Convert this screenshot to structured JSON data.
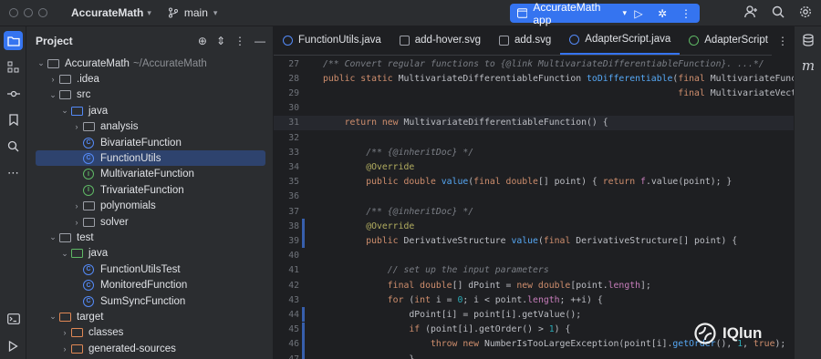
{
  "titlebar": {
    "project": "AccurateMath",
    "branch": "main",
    "run_config": "AccurateMath app"
  },
  "project_panel": {
    "title": "Project",
    "tree": [
      {
        "label": "AccurateMath",
        "suffix": "~/AccurateMath",
        "depth": 0,
        "arrow": "▾",
        "icon": "folder"
      },
      {
        "label": ".idea",
        "depth": 1,
        "arrow": "›",
        "icon": "folder"
      },
      {
        "label": "src",
        "depth": 1,
        "arrow": "▾",
        "icon": "folder"
      },
      {
        "label": "java",
        "depth": 2,
        "arrow": "▾",
        "icon": "folder-blue"
      },
      {
        "label": "analysis",
        "depth": 3,
        "arrow": "›",
        "icon": "package"
      },
      {
        "label": "BivariateFunction",
        "depth": 3,
        "arrow": "",
        "icon": "class"
      },
      {
        "label": "FunctionUtils",
        "depth": 3,
        "arrow": "",
        "icon": "class",
        "selected": true
      },
      {
        "label": "MultivariateFunction",
        "depth": 3,
        "arrow": "",
        "icon": "interface"
      },
      {
        "label": "TrivariateFunction",
        "depth": 3,
        "arrow": "",
        "icon": "interface"
      },
      {
        "label": "polynomials",
        "depth": 3,
        "arrow": "›",
        "icon": "package"
      },
      {
        "label": "solver",
        "depth": 3,
        "arrow": "›",
        "icon": "package"
      },
      {
        "label": "test",
        "depth": 1,
        "arrow": "▾",
        "icon": "folder"
      },
      {
        "label": "java",
        "depth": 2,
        "arrow": "▾",
        "icon": "folder-green"
      },
      {
        "label": "FunctionUtilsTest",
        "depth": 3,
        "arrow": "",
        "icon": "class"
      },
      {
        "label": "MonitoredFunction",
        "depth": 3,
        "arrow": "",
        "icon": "class"
      },
      {
        "label": "SumSyncFunction",
        "depth": 3,
        "arrow": "",
        "icon": "class"
      },
      {
        "label": "target",
        "depth": 1,
        "arrow": "▾",
        "icon": "folder-orange"
      },
      {
        "label": "classes",
        "depth": 2,
        "arrow": "›",
        "icon": "folder-orange"
      },
      {
        "label": "generated-sources",
        "depth": 2,
        "arrow": "›",
        "icon": "folder-orange"
      }
    ]
  },
  "tabs": [
    {
      "label": "FunctionUtils.java",
      "icon": "class"
    },
    {
      "label": "add-hover.svg",
      "icon": "svg"
    },
    {
      "label": "add.svg",
      "icon": "svg"
    },
    {
      "label": "AdapterScript.java",
      "icon": "class",
      "active": true
    },
    {
      "label": "AdapterScript",
      "icon": "green"
    }
  ],
  "code_lines": [
    {
      "num": "27",
      "mark": "",
      "html": "<span class=\"c\">/** Convert regular functions to {@link MultivariateDifferentiableFunction}. ...*/</span>"
    },
    {
      "num": "28",
      "mark": "",
      "html": "<span class=\"k\">public static </span>MultivariateDifferentiableFunction <span class=\"f\">toDifferentiable</span>(<span class=\"k\">final </span>MultivariateFunctio"
    },
    {
      "num": "29",
      "mark": "",
      "html": "                                                                  <span class=\"k\">final </span>MultivariateVectorF"
    },
    {
      "num": "30",
      "mark": "",
      "html": ""
    },
    {
      "num": "31",
      "mark": "",
      "html": "    <span class=\"k\">return new </span>MultivariateDifferentiableFunction() {",
      "hl": true
    },
    {
      "num": "32",
      "mark": "",
      "html": ""
    },
    {
      "num": "33",
      "mark": "",
      "html": "        <span class=\"c\">/** {@inheritDoc} */</span>"
    },
    {
      "num": "34",
      "mark": "",
      "html": "        <span class=\"a\">@Override</span>"
    },
    {
      "num": "35",
      "mark": "",
      "html": "        <span class=\"k\">public double </span><span class=\"f\">value</span>(<span class=\"k\">final double</span>[] point) { <span class=\"k\">return </span><span class=\"fld\">f</span>.value(point); }"
    },
    {
      "num": "36",
      "mark": "",
      "html": ""
    },
    {
      "num": "37",
      "mark": "",
      "html": "        <span class=\"c\">/** {@inheritDoc} */</span>"
    },
    {
      "num": "38",
      "mark": "mod",
      "html": "        <span class=\"a\">@Override</span>"
    },
    {
      "num": "39",
      "mark": "mod",
      "html": "        <span class=\"k\">public </span>DerivativeStructure <span class=\"f\">value</span>(<span class=\"k\">final </span>DerivativeStructure[] point) {"
    },
    {
      "num": "40",
      "mark": "",
      "html": ""
    },
    {
      "num": "41",
      "mark": "",
      "html": "            <span class=\"c\">// set up the input parameters</span>"
    },
    {
      "num": "42",
      "mark": "",
      "html": "            <span class=\"k\">final double</span>[] dPoint = <span class=\"k\">new double</span>[point.<span class=\"fld\">length</span>];"
    },
    {
      "num": "43",
      "mark": "",
      "html": "            <span class=\"k\">for </span>(<span class=\"k\">int </span>i = <span class=\"n\">0</span>; i &lt; point.<span class=\"fld\">length</span>; ++i) {"
    },
    {
      "num": "44",
      "mark": "mod",
      "html": "                dPoint[i] = point[i].getValue();"
    },
    {
      "num": "45",
      "mark": "mod",
      "html": "                <span class=\"k\">if </span>(point[i].getOrder() &gt; <span class=\"n\">1</span>) {"
    },
    {
      "num": "46",
      "mark": "mod",
      "html": "                    <span class=\"k\">throw new </span>NumberIsTooLargeException(point[i].<span class=\"f\">getOrder</span>(), <span class=\"n\">1</span>, <span class=\"k\">true</span>);"
    },
    {
      "num": "47",
      "mark": "mod",
      "html": "                }"
    }
  ],
  "watermark": "IQlun"
}
